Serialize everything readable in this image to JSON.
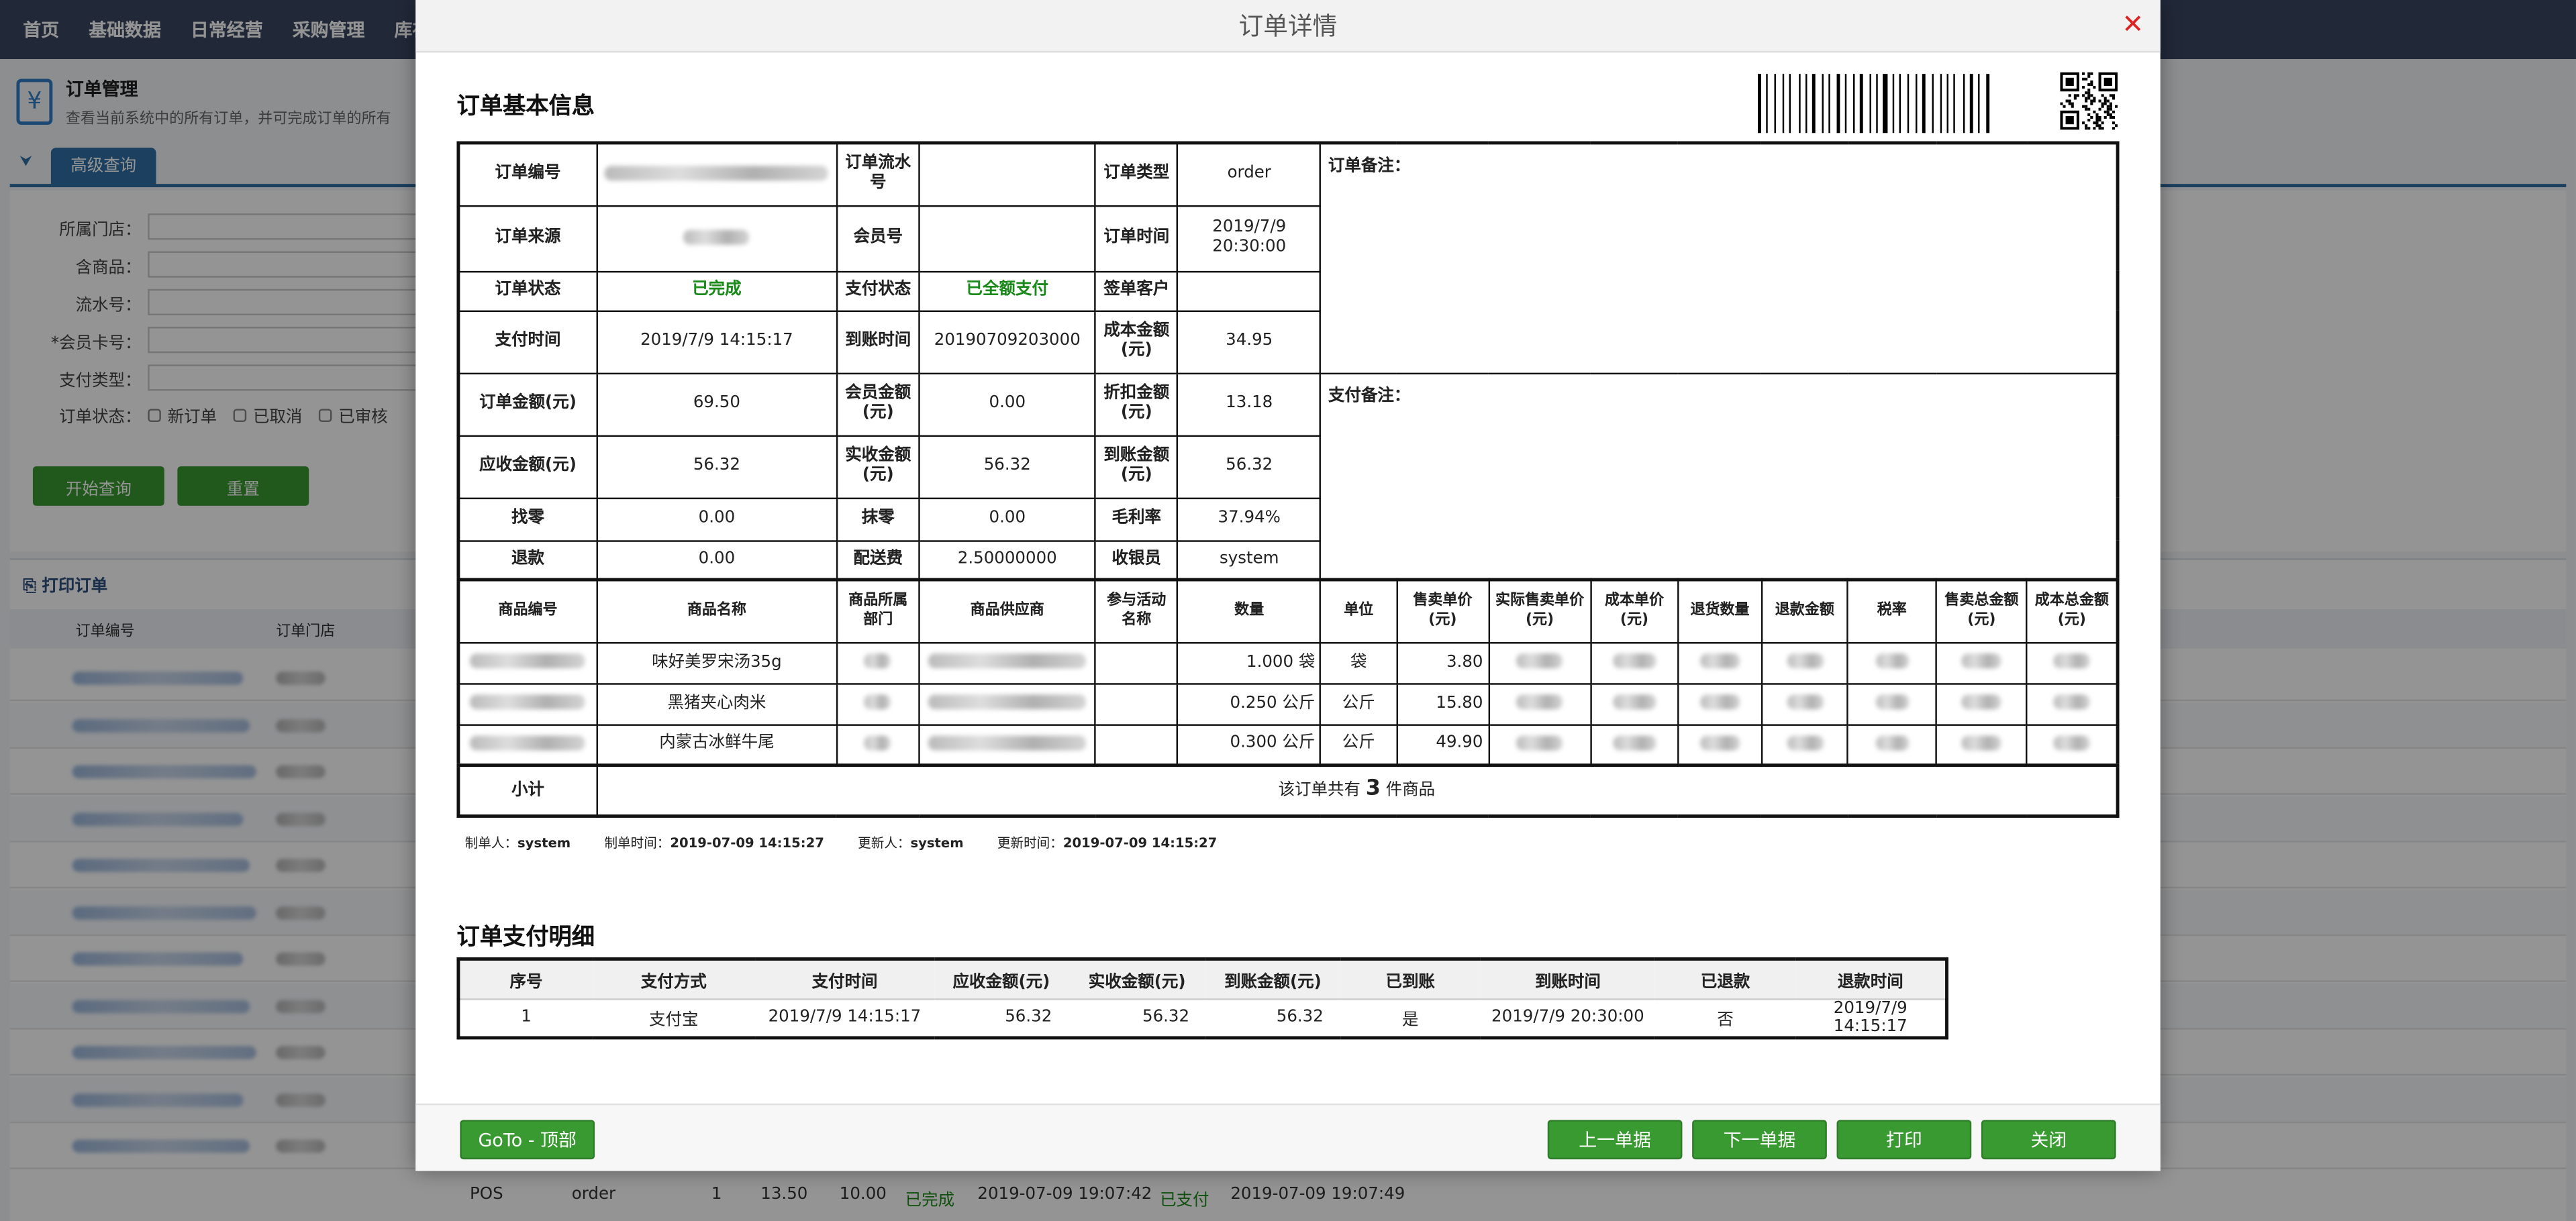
{
  "nav": [
    "首页",
    "基础数据",
    "日常经营",
    "采购管理",
    "库存管"
  ],
  "page": {
    "title": "订单管理",
    "subtitle": "查看当前系统中的所有订单，并可完成订单的所有",
    "icon": "yen-icon"
  },
  "tab": {
    "label": "高级查询"
  },
  "filters": {
    "store_label": "所属门店：",
    "goods_label": "含商品：",
    "serial_label": "流水号：",
    "member_label": "*会员卡号：",
    "paytype_label": "支付类型：",
    "status_label": "订单状态：",
    "status_options": [
      "新订单",
      "已取消",
      "已审核"
    ],
    "search_button": "开始查询",
    "reset_button": "重置"
  },
  "list": {
    "title": "打印订单",
    "col_order_no": "订单编号",
    "col_store": "订单门店",
    "last_row": {
      "source": "POS",
      "type": "order",
      "qty": "1",
      "amount": "13.50",
      "paid": "10.00",
      "status": "已完成",
      "time": "2019-07-09 19:07:42",
      "pay_status": "已支付",
      "pay_time": "2019-07-09 19:07:49"
    }
  },
  "modal": {
    "title": "订单详情",
    "close_icon": "close-icon",
    "basic_section": "订单基本信息",
    "info": {
      "order_no_label": "订单编号",
      "order_serial_label": "订单流水号",
      "order_type_label": "订单类型",
      "order_type": "order",
      "order_note_label": "订单备注：",
      "order_source_label": "订单来源",
      "member_no_label": "会员号",
      "order_time_label": "订单时间",
      "order_time": "2019/7/9 20:30:00",
      "order_status_label": "订单状态",
      "order_status": "已完成",
      "pay_status_label": "支付状态",
      "pay_status": "已全额支付",
      "sign_customer_label": "签单客户",
      "pay_time_label": "支付时间",
      "pay_time": "2019/7/9 14:15:17",
      "arrive_time_label": "到账时间",
      "arrive_time": "20190709203000",
      "cost_label": "成本金额(元)",
      "cost": "34.95",
      "order_amount_label": "订单金额(元)",
      "order_amount": "69.50",
      "member_amount_label": "会员金额(元)",
      "member_amount": "0.00",
      "discount_label": "折扣金额(元)",
      "discount": "13.18",
      "pay_note_label": "支付备注：",
      "receivable_label": "应收金额(元)",
      "receivable": "56.32",
      "actual_label": "实收金额(元)",
      "actual": "56.32",
      "arrived_label": "到账金额(元)",
      "arrived": "56.32",
      "change_label": "找零",
      "change": "0.00",
      "round_label": "抹零",
      "round": "0.00",
      "margin_label": "毛利率",
      "margin": "37.94%",
      "refund_label": "退款",
      "refund": "0.00",
      "delivery_label": "配送费",
      "delivery": "2.50000000",
      "cashier_label": "收银员",
      "cashier": "system"
    },
    "goods_headers": [
      "商品编号",
      "商品名称",
      "商品所属部门",
      "商品供应商",
      "参与活动名称",
      "数量",
      "单位",
      "售卖单价(元)",
      "实际售卖单价(元)",
      "成本单价(元)",
      "退货数量",
      "退款金额",
      "税率",
      "售卖总金额(元)",
      "成本总金额(元)"
    ],
    "goods": [
      {
        "name": "味好美罗宋汤35g",
        "qty": "1.000 袋",
        "unit": "袋",
        "price": "3.80"
      },
      {
        "name": "黑猪夹心肉米",
        "qty": "0.250 公斤",
        "unit": "公斤",
        "price": "15.80"
      },
      {
        "name": "内蒙古冰鲜牛尾",
        "qty": "0.300 公斤",
        "unit": "公斤",
        "price": "49.90"
      }
    ],
    "subtotal_label": "小计",
    "subtotal_prefix": "该订单共有",
    "subtotal_count": "3",
    "subtotal_suffix": "件商品",
    "meta": {
      "creator_label": "制单人：",
      "creator": "system",
      "create_time_label": "制单时间：",
      "create_time": "2019-07-09 14:15:27",
      "updater_label": "更新人：",
      "updater": "system",
      "update_time_label": "更新时间：",
      "update_time": "2019-07-09 14:15:27"
    },
    "pay_section": "订单支付明细",
    "pay_headers": [
      "序号",
      "支付方式",
      "支付时间",
      "应收金额(元)",
      "实收金额(元)",
      "到账金额(元)",
      "已到账",
      "到账时间",
      "已退款",
      "退款时间"
    ],
    "pay_rows": [
      [
        "1",
        "支付宝",
        "2019/7/9 14:15:17",
        "56.32",
        "56.32",
        "56.32",
        "是",
        "2019/7/9 20:30:00",
        "否",
        "2019/7/9 14:15:17"
      ]
    ],
    "footer": {
      "goto_top": "GoTo - 顶部",
      "prev": "上一单据",
      "next": "下一单据",
      "print": "打印",
      "close": "关闭"
    }
  }
}
